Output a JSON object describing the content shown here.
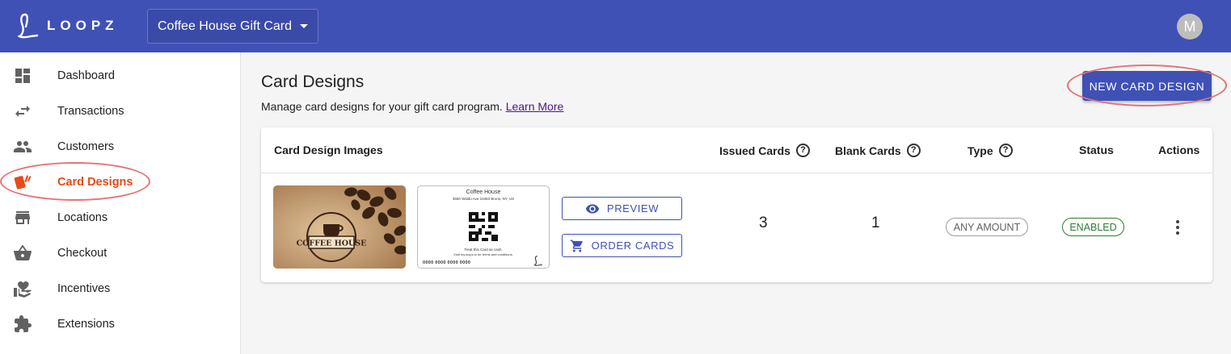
{
  "app": {
    "name": "LOOPZ",
    "program_selected": "Coffee House Gift Card",
    "avatar_initial": "M"
  },
  "sidebar": {
    "items": [
      {
        "label": "Dashboard",
        "icon": "dashboard-icon"
      },
      {
        "label": "Transactions",
        "icon": "swap-arrows-icon"
      },
      {
        "label": "Customers",
        "icon": "people-icon"
      },
      {
        "label": "Card Designs",
        "icon": "cards-icon",
        "active": true
      },
      {
        "label": "Locations",
        "icon": "storefront-icon"
      },
      {
        "label": "Checkout",
        "icon": "basket-icon"
      },
      {
        "label": "Incentives",
        "icon": "hand-heart-icon"
      },
      {
        "label": "Extensions",
        "icon": "puzzle-icon"
      }
    ]
  },
  "main": {
    "title": "Card Designs",
    "subtitle": "Manage card designs for your gift card program.",
    "learn_more": "Learn More",
    "new_button": "NEW CARD DESIGN"
  },
  "table": {
    "headers": [
      "Card Design Images",
      "Issued Cards",
      "Blank Cards",
      "Type",
      "Status",
      "Actions"
    ],
    "help_glyph": "?",
    "rows": [
      {
        "front_text": "COFFEE HOUSE",
        "back": {
          "name": "Coffee House",
          "address": "3660 Waldo Ave 10463 Bronx, NY, US",
          "treat_text": "Treat this Card as cash.",
          "visit_text": "Visit my.loopz.io for terms and conditions.",
          "card_number": "0000 0000 0000 0000"
        },
        "preview_label": "PREVIEW",
        "order_label": "ORDER CARDS",
        "issued": "3",
        "blank": "1",
        "type": "ANY AMOUNT",
        "status": "ENABLED"
      }
    ]
  },
  "colors": {
    "primary": "#3f51b5",
    "active": "#e64a19",
    "enabled": "#2e7d32",
    "highlight_ring": "#e57373"
  }
}
